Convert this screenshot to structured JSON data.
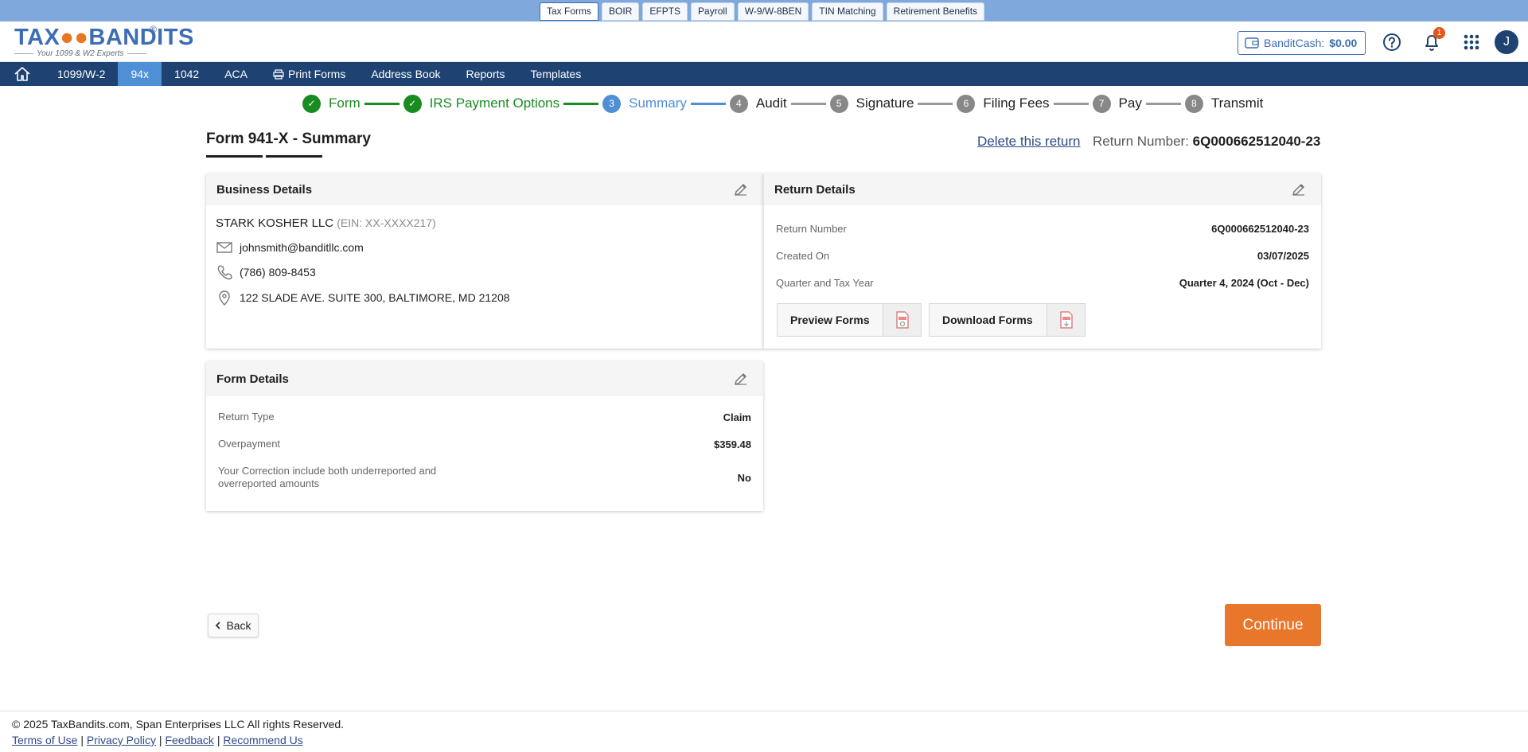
{
  "top_tabs": [
    "Tax Forms",
    "BOIR",
    "EFPTS",
    "Payroll",
    "W-9/W-8BEN",
    "TIN Matching",
    "Retirement Benefits"
  ],
  "logo": {
    "brand_left": "TAX",
    "brand_mask": "உஉ",
    "brand_right": "BANDITS",
    "reg": "®",
    "tagline": "Your 1099 & W2 Experts"
  },
  "header": {
    "bandit_label": "BanditCash:",
    "bandit_amount": "$0.00",
    "notification_count": "1",
    "avatar_initial": "J"
  },
  "nav": [
    "1099/W-2",
    "94x",
    "1042",
    "ACA",
    "Print Forms",
    "Address Book",
    "Reports",
    "Templates"
  ],
  "steps": [
    {
      "num": "✓",
      "label": "Form",
      "state": "done"
    },
    {
      "num": "✓",
      "label": "IRS Payment Options",
      "state": "done"
    },
    {
      "num": "3",
      "label": "Summary",
      "state": "current"
    },
    {
      "num": "4",
      "label": "Audit",
      "state": "todo"
    },
    {
      "num": "5",
      "label": "Signature",
      "state": "todo"
    },
    {
      "num": "6",
      "label": "Filing Fees",
      "state": "todo"
    },
    {
      "num": "7",
      "label": "Pay",
      "state": "todo"
    },
    {
      "num": "8",
      "label": "Transmit",
      "state": "todo"
    }
  ],
  "page": {
    "title": "Form 941-X - Summary",
    "delete_label": "Delete this return",
    "return_number_label": "Return Number:",
    "return_number": "6Q000662512040-23"
  },
  "business": {
    "heading": "Business Details",
    "company": "STARK KOSHER LLC",
    "ein": "(EIN: XX-XXXX217)",
    "email": "johnsmith@banditllc.com",
    "phone": "(786) 809-8453",
    "address": "122 SLADE AVE. SUITE 300, BALTIMORE, MD 21208"
  },
  "return_details": {
    "heading": "Return Details",
    "rows": [
      {
        "k": "Return Number",
        "v": "6Q000662512040-23"
      },
      {
        "k": "Created On",
        "v": "03/07/2025"
      },
      {
        "k": "Quarter and Tax Year",
        "v": "Quarter 4, 2024 (Oct - Dec)"
      }
    ],
    "preview_label": "Preview Forms",
    "download_label": "Download Forms"
  },
  "form_details": {
    "heading": "Form Details",
    "rows": [
      {
        "k": "Return Type",
        "v": "Claim"
      },
      {
        "k": "Overpayment",
        "v": "$359.48"
      },
      {
        "k": "Your Correction include both underreported and overreported amounts",
        "v": "No"
      }
    ]
  },
  "buttons": {
    "back": "Back",
    "continue": "Continue"
  },
  "footer": {
    "copyright": "© 2025 TaxBandits.com, Span Enterprises LLC All rights Reserved.",
    "links": [
      "Terms of Use",
      "Privacy Policy",
      "Feedback",
      "Recommend Us"
    ]
  },
  "colors": {
    "nav": "#1e4271",
    "accent": "#4f8fd6",
    "done": "#188b21",
    "cta": "#e8762b",
    "strip": "#7fa9dd"
  }
}
